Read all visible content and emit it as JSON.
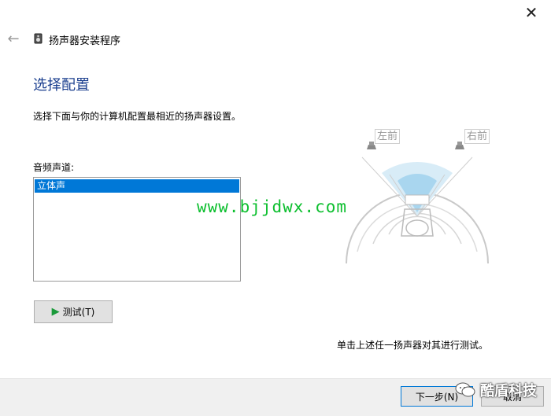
{
  "window": {
    "title": "扬声器安装程序",
    "close_glyph": "✕",
    "back_glyph": "←"
  },
  "page": {
    "heading": "选择配置",
    "description": "选择下面与你的计算机配置最相近的扬声器设置。"
  },
  "channels": {
    "label": "音频声道:",
    "items": [
      {
        "label": "立体声",
        "selected": true
      }
    ]
  },
  "test_button": {
    "label": "测试(T)",
    "icon": "play-icon"
  },
  "diagram": {
    "left_label": "左前",
    "right_label": "右前",
    "hint": "单击上述任一扬声器对其进行测试。"
  },
  "footer": {
    "next_label": "下一步(N)",
    "cancel_label": "取消"
  },
  "overlays": {
    "url_watermark": "www.bjjdwx.com",
    "wechat_account": "酷盾科技"
  },
  "colors": {
    "accent": "#0078d7",
    "heading": "#1b3f8f",
    "watermark": "#0dbf2f"
  }
}
